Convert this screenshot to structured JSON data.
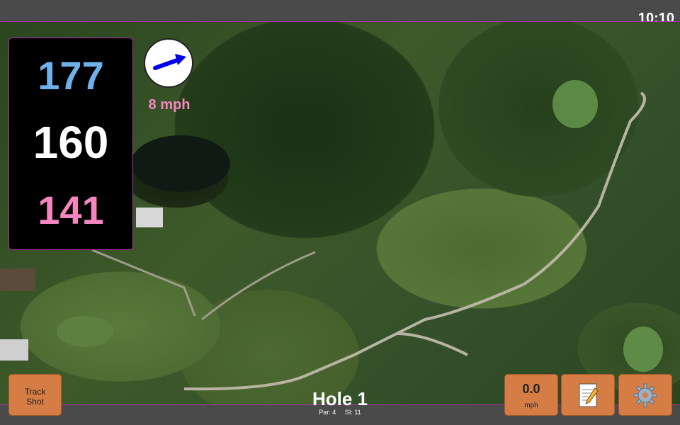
{
  "status": {
    "time": "10:10"
  },
  "distances": {
    "back": "177",
    "middle": "160",
    "front": "141",
    "colors": {
      "back": "#6fb1ea",
      "middle": "#ffffff",
      "front": "#f586bf"
    }
  },
  "wind": {
    "speed_text": "8 mph",
    "direction_icon": "arrow-right-up-icon"
  },
  "buttons": {
    "track_shot": {
      "line1": "Track",
      "line2": "Shot"
    },
    "wind_reading": {
      "value": "0.0",
      "unit": "mph"
    },
    "notes": {
      "icon": "notepad-icon"
    },
    "settings": {
      "icon": "gear-icon"
    }
  },
  "hole": {
    "title": "Hole 1",
    "par": "Par: 4",
    "si": "SI: 11"
  },
  "theme": {
    "button_color": "#d57d45",
    "accent_border": "#b02fb0"
  }
}
